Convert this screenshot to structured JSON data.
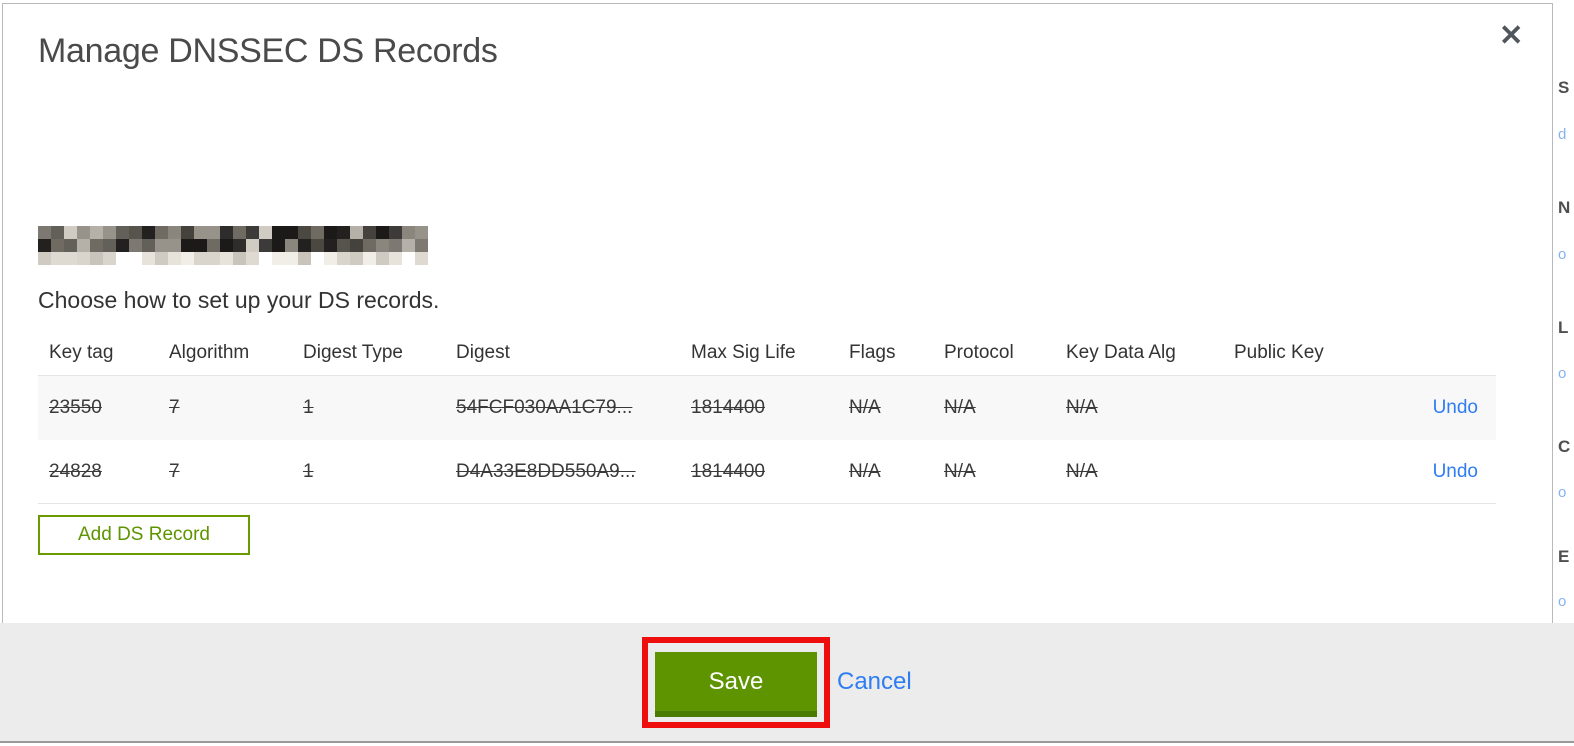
{
  "modal": {
    "title": "Manage DNSSEC DS Records",
    "close_icon": "✕",
    "domain_redacted": true,
    "instruction": "Choose how to set up your DS records.",
    "table": {
      "headers": [
        "Key tag",
        "Algorithm",
        "Digest Type",
        "Digest",
        "Max Sig Life",
        "Flags",
        "Protocol",
        "Key Data Alg",
        "Public Key"
      ],
      "rows": [
        {
          "key_tag": "23550",
          "algorithm": "7",
          "digest_type": "1",
          "digest": "54FCF030AA1C79...",
          "max_sig_life": "1814400",
          "flags": "N/A",
          "protocol": "N/A",
          "key_data_alg": "N/A",
          "public_key": "",
          "action": "Undo",
          "struck": true
        },
        {
          "key_tag": "24828",
          "algorithm": "7",
          "digest_type": "1",
          "digest": "D4A33E8DD550A9...",
          "max_sig_life": "1814400",
          "flags": "N/A",
          "protocol": "N/A",
          "key_data_alg": "N/A",
          "public_key": "",
          "action": "Undo",
          "struck": true
        }
      ]
    },
    "add_button_label": "Add DS Record"
  },
  "footer": {
    "save_label": "Save",
    "cancel_label": "Cancel",
    "save_annotated_with_red_box": true
  },
  "background_peek": [
    {
      "label": "S",
      "link": "d"
    },
    {
      "label": "N",
      "link": "o"
    },
    {
      "label": "L",
      "link": "o"
    },
    {
      "label": "C",
      "link": "o"
    },
    {
      "label": "E",
      "link": "o"
    }
  ],
  "colors": {
    "accent_green": "#5e9400",
    "accent_green_dark": "#4b7a00",
    "link_blue": "#2e7df2",
    "annotation_red": "#ee0e0e",
    "footer_bg": "#ececec",
    "row_stripe": "#f8f8f8"
  }
}
